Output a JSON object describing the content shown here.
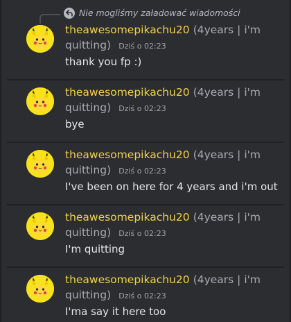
{
  "reply": {
    "text": "Nie mogliśmy załadować wiadomości",
    "icon": "reply-icon"
  },
  "author": {
    "name": "theawesomepikachu20",
    "tag": "(4years | i'm quitting)",
    "avatar": "pikachu-avatar"
  },
  "messages": [
    {
      "timestamp": "Dziś o 02:23",
      "text": "thank you fp :)"
    },
    {
      "timestamp": "Dziś o 02:23",
      "text": "bye"
    },
    {
      "timestamp": "Dziś o 02:23",
      "text": "I've been on here for 4 years and i'm out"
    },
    {
      "timestamp": "Dziś o 02:23",
      "text": "I'm quitting"
    },
    {
      "timestamp": "Dziś o 02:23",
      "text": "I'ma say it here too"
    }
  ],
  "colors": {
    "background": "#2b2d31",
    "username": "#f2d14a",
    "text": "#e3e5e8",
    "muted": "#a7abb2"
  }
}
